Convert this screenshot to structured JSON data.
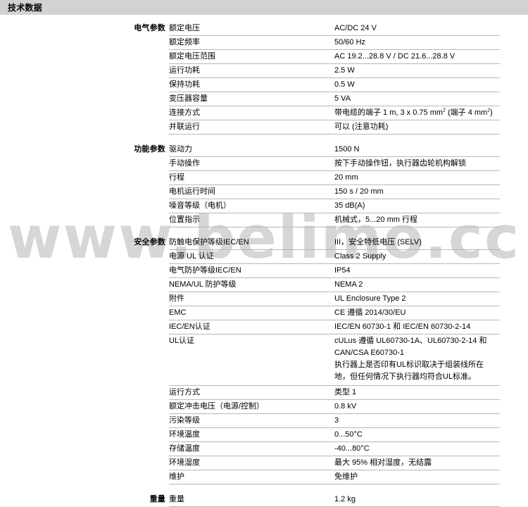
{
  "header": {
    "title": "技术数据"
  },
  "watermark": {
    "text": "www.belimo.cc"
  },
  "sections": [
    {
      "label": "电气参数",
      "rows": [
        {
          "name": "额定电压",
          "value": "AC/DC 24 V"
        },
        {
          "name": "额定频率",
          "value": "50/60 Hz"
        },
        {
          "name": "额定电压范围",
          "value": "AC 19.2...28.8 V / DC 21.6...28.8 V"
        },
        {
          "name": "运行功耗",
          "value": "2.5 W"
        },
        {
          "name": "保持功耗",
          "value": "0.5 W"
        },
        {
          "name": "变压器容量",
          "value": "5 VA"
        },
        {
          "name": "连接方式",
          "value": "带电缆的端子 1 m, 3 x 0.75 mm² (端子 4 mm²)"
        },
        {
          "name": "并联运行",
          "value": "可以 (注意功耗)"
        }
      ]
    },
    {
      "label": "功能参数",
      "rows": [
        {
          "name": "驱动力",
          "value": "1500 N"
        },
        {
          "name": "手动操作",
          "value": "按下手动操作钮，执行器齿轮机构解锁"
        },
        {
          "name": "行程",
          "value": "20 mm"
        },
        {
          "name": "电机运行时间",
          "value": "150 s / 20 mm"
        },
        {
          "name": "噪音等级（电机）",
          "value": "35 dB(A)"
        },
        {
          "name": "位置指示",
          "value": "机械式，5...20 mm 行程"
        }
      ]
    },
    {
      "label": "安全参数",
      "rows": [
        {
          "name": "防触电保护等级IEC/EN",
          "value": "III，安全特低电压 (SELV)"
        },
        {
          "name": "电源 UL 认证",
          "value": "Class 2 Supply"
        },
        {
          "name": "电气防护等级IEC/EN",
          "value": "IP54"
        },
        {
          "name": "NEMA/UL 防护等级",
          "value": "NEMA 2"
        },
        {
          "name": "附件",
          "value": "UL Enclosure Type 2"
        },
        {
          "name": "EMC",
          "value": "CE 遵循 2014/30/EU"
        },
        {
          "name": "IEC/EN认证",
          "value": "IEC/EN 60730-1 和 IEC/EN 60730-2-14"
        },
        {
          "name": "UL认证",
          "value": "cULus 遵循 UL60730-1A、UL60730-2-14 和\nCAN/CSA E60730-1\n执行器上是否印有UL标识取决于组装线所在\n地，但任何情况下执行器均符合UL标准。",
          "multiline": true
        },
        {
          "name": "运行方式",
          "value": "类型 1"
        },
        {
          "name": "额定冲击电压（电源/控制）",
          "value": "0.8 kV"
        },
        {
          "name": "污染等级",
          "value": "3"
        },
        {
          "name": "环境温度",
          "value": "0...50°C"
        },
        {
          "name": "存储温度",
          "value": "-40...80°C"
        },
        {
          "name": "环境湿度",
          "value": "最大 95% 相对湿度，无结露"
        },
        {
          "name": "维护",
          "value": "免维护"
        }
      ]
    },
    {
      "label": "重量",
      "rows": [
        {
          "name": "重量",
          "value": "1.2 kg"
        }
      ]
    }
  ]
}
